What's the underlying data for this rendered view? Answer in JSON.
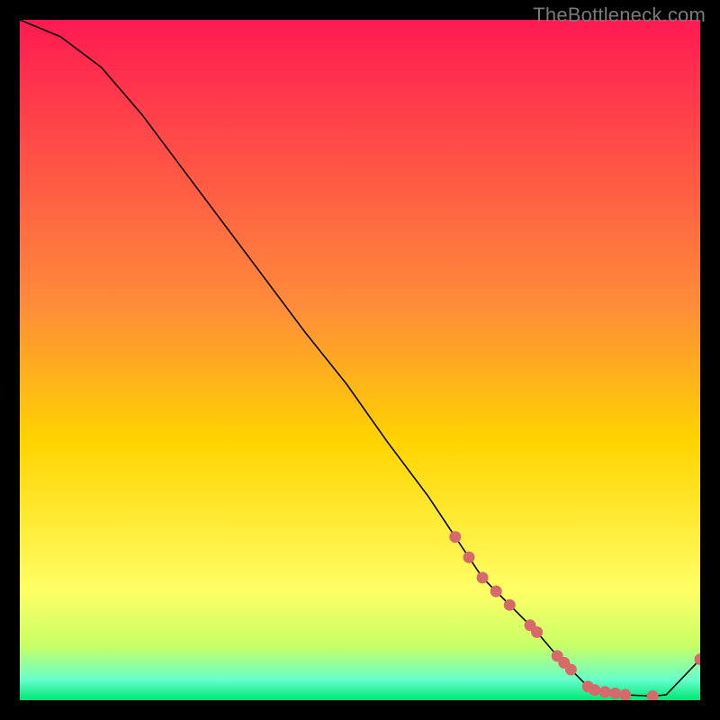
{
  "watermark": "TheBottleneck.com",
  "chart_data": {
    "type": "line",
    "title": "",
    "xlabel": "",
    "ylabel": "",
    "xlim": [
      0,
      100
    ],
    "ylim": [
      0,
      100
    ],
    "x": [
      0,
      6,
      12,
      18,
      24,
      30,
      36,
      42,
      48,
      54,
      60,
      64,
      66,
      68,
      70,
      72,
      75,
      76,
      79,
      80,
      81,
      83.5,
      84.5,
      86,
      87.5,
      89,
      93,
      95,
      100
    ],
    "values": [
      100,
      97.5,
      93,
      86,
      78,
      70,
      62,
      54,
      46.5,
      38,
      30,
      24,
      21,
      18,
      16,
      14,
      11,
      10,
      6.5,
      5.5,
      4.5,
      2,
      1.5,
      1.2,
      1,
      0.8,
      0.6,
      0.8,
      6
    ],
    "markers": {
      "x": [
        64,
        66,
        68,
        70,
        72,
        75,
        76,
        79,
        80,
        81,
        83.5,
        84.5,
        86,
        87.5,
        89,
        93,
        100
      ],
      "values": [
        24,
        21,
        18,
        16,
        14,
        11,
        10,
        6.5,
        5.5,
        4.5,
        2,
        1.5,
        1.2,
        1,
        0.8,
        0.6,
        6
      ]
    },
    "colors": {
      "line": "#000000",
      "marker": "#d66a6a",
      "gradient_top": "#ff1a52",
      "gradient_mid": "#ffd400",
      "gradient_low": "#ffff66",
      "gradient_bottom": "#00e676"
    }
  }
}
